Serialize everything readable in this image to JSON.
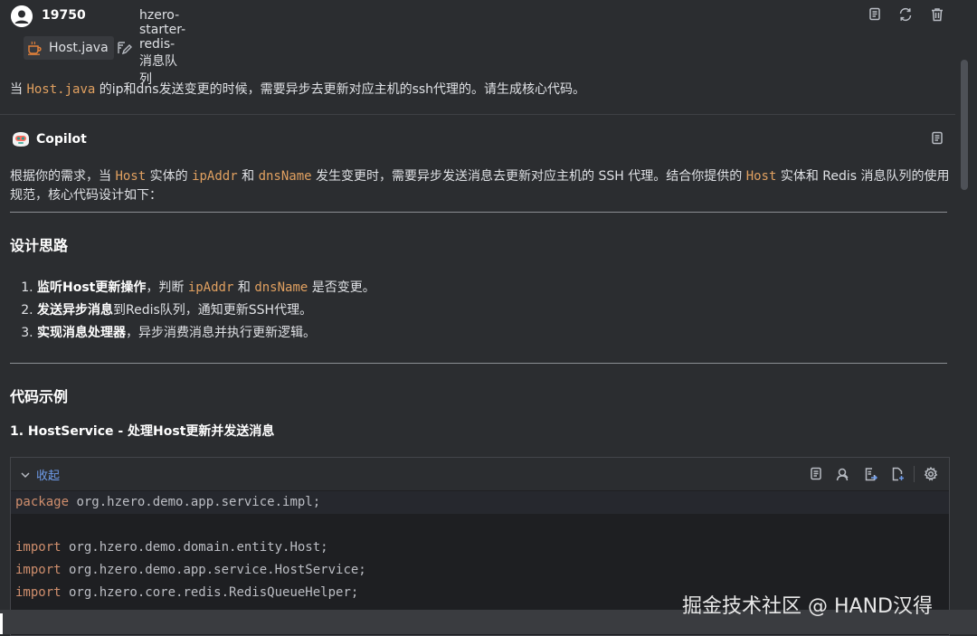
{
  "user": {
    "name": "19750"
  },
  "context": {
    "file_chip": "Host.java",
    "skill_chip": "hzero-starter-redis-消息队列"
  },
  "prompt": {
    "before": "当 ",
    "code": "Host.java",
    "after": " 的ip和dns发送变更的时候，需要异步去更新对应主机的ssh代理的。请生成核心代码。"
  },
  "copilot": {
    "name": "Copilot",
    "intro": {
      "p1": "根据你的需求，当 ",
      "c1": "Host",
      "p2": " 实体的 ",
      "c2": "ipAddr",
      "p3": " 和 ",
      "c3": "dnsName",
      "p4": " 发生变更时，需要异步发送消息去更新对应主机的 SSH 代理。结合你提供的 ",
      "c4": "Host",
      "p5": " 实体和 Redis 消息队列的使用规范，核心代码设计如下："
    },
    "design_heading": "设计思路",
    "steps": [
      {
        "bold": "监听Host更新操作",
        "a": "，判断 ",
        "c1": "ipAddr",
        "b": " 和 ",
        "c2": "dnsName",
        "c": " 是否变更。"
      },
      {
        "bold": "发送异步消息",
        "a": "到Redis队列，通知更新SSH代理。"
      },
      {
        "bold": "实现消息处理器",
        "a": "，异步消费消息并执行更新逻辑。"
      }
    ],
    "code_heading": "代码示例",
    "sub_heading": "1. HostService - 处理Host更新并发送消息",
    "code_block": {
      "collapse_label": "收起",
      "lines": [
        {
          "kw": "package",
          "rest": " org.hzero.demo.app.service.impl;"
        },
        {
          "kw": "",
          "rest": ""
        },
        {
          "kw": "import",
          "rest": " org.hzero.demo.domain.entity.Host;"
        },
        {
          "kw": "import",
          "rest": " org.hzero.demo.app.service.HostService;"
        },
        {
          "kw": "import",
          "rest": " org.hzero.core.redis.RedisQueueHelper;"
        }
      ]
    }
  },
  "watermark": "掘金技术社区 @ HAND汉得",
  "colors": {
    "accent_link": "#6e9be8",
    "identifier": "#e0a060",
    "keyword": "#cf8e6d",
    "background": "#2b2d30"
  }
}
